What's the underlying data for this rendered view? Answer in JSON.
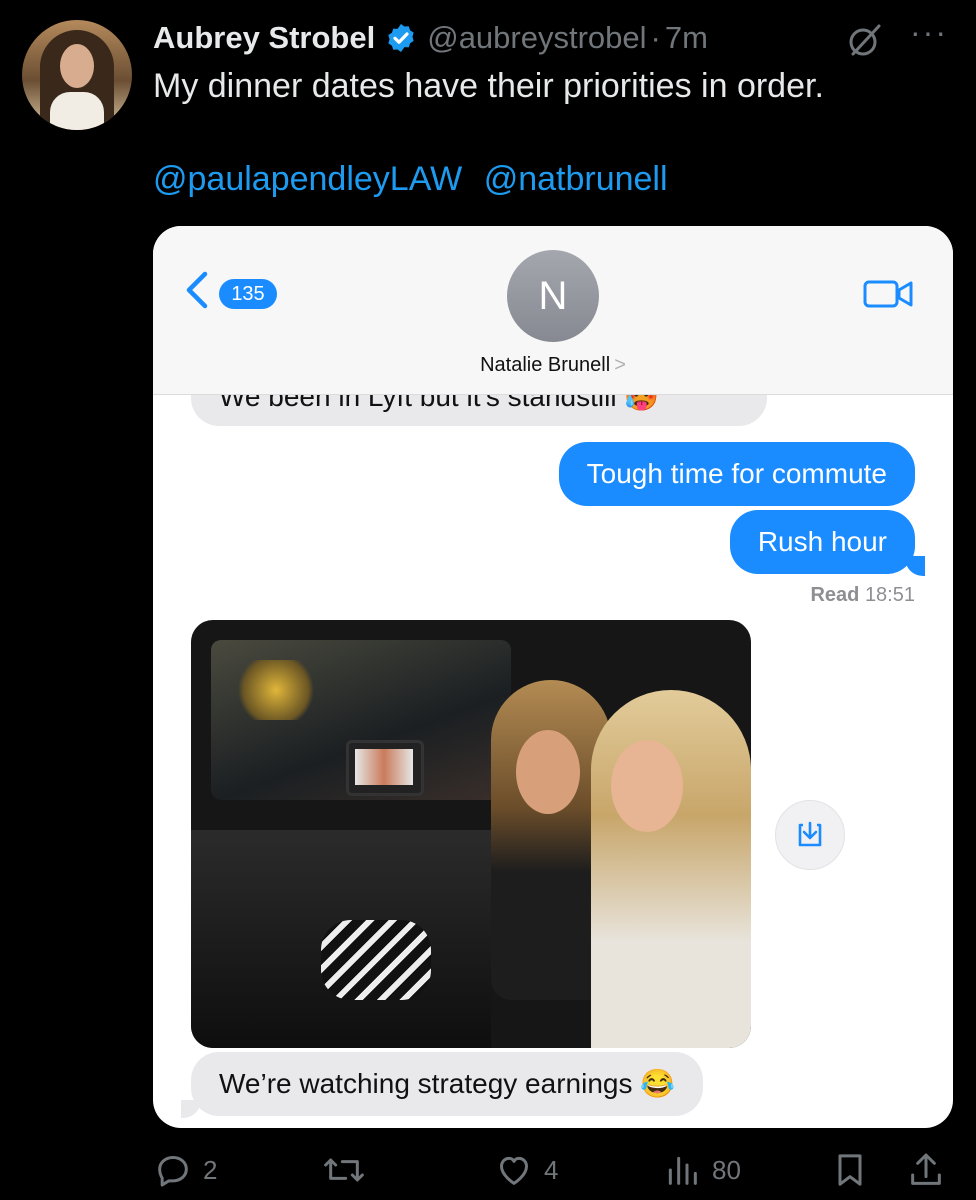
{
  "tweet": {
    "author_name": "Aubrey Strobel",
    "handle": "@aubreystrobel",
    "separator": "·",
    "time": "7m",
    "text": "My dinner dates have their priorities in order.",
    "mentions": [
      "@paulapendleyLAW",
      "@natbrunell"
    ],
    "more_label": "···",
    "accent_color": "#1d9bf0"
  },
  "imessage": {
    "back_count": "135",
    "contact_initial": "N",
    "contact_name": "Natalie Brunell",
    "chevron": ">",
    "messages": {
      "cut_incoming": "We been in Lyft but it's standstill 🥵",
      "out_1": "Tough time for commute",
      "out_2": "Rush hour",
      "read_label": "Read",
      "read_time": "18:51",
      "in_last": "We’re watching strategy earnings 😂"
    },
    "bubble_colors": {
      "outgoing": "#1a8cff",
      "incoming": "#e9e9eb"
    }
  },
  "actions": {
    "replies": "2",
    "retweets": "",
    "likes": "4",
    "views": "80"
  }
}
